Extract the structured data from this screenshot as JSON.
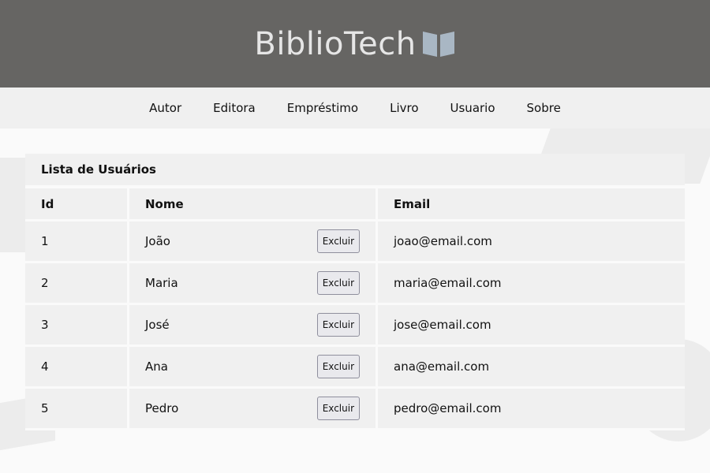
{
  "header": {
    "logo_text": "BiblioTech",
    "logo_icon": "open-book-icon",
    "logo_icon_color": "#a9b7c4"
  },
  "nav": {
    "items": [
      "Autor",
      "Editora",
      "Empréstimo",
      "Livro",
      "Usuario",
      "Sobre"
    ]
  },
  "table": {
    "title": "Lista de Usuários",
    "columns": [
      "Id",
      "Nome",
      "Email"
    ],
    "delete_label": "Excluir",
    "rows": [
      {
        "id": "1",
        "nome": "João",
        "email": "joao@email.com"
      },
      {
        "id": "2",
        "nome": "Maria",
        "email": "maria@email.com"
      },
      {
        "id": "3",
        "nome": "José",
        "email": "jose@email.com"
      },
      {
        "id": "4",
        "nome": "Ana",
        "email": "ana@email.com"
      },
      {
        "id": "5",
        "nome": "Pedro",
        "email": "pedro@email.com"
      }
    ]
  }
}
